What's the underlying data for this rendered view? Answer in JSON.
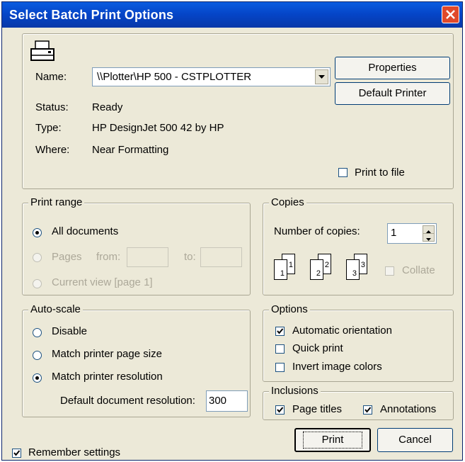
{
  "window": {
    "title": "Select Batch Print Options"
  },
  "printer": {
    "name_label": "Name:",
    "name_value": "\\\\Plotter\\HP 500 - CSTPLOTTER",
    "status_label": "Status:",
    "status_value": "Ready",
    "type_label": "Type:",
    "type_value": "HP DesignJet 500 42 by HP",
    "where_label": "Where:",
    "where_value": "Near Formatting",
    "properties_label": "Properties",
    "default_printer_label": "Default Printer",
    "print_to_file_label": "Print to file",
    "print_to_file_checked": false
  },
  "print_range": {
    "legend": "Print range",
    "all_documents_label": "All documents",
    "pages_label": "Pages",
    "from_label": "from:",
    "to_label": "to:",
    "from_value": "",
    "to_value": "",
    "current_view_label": "Current view [page 1]",
    "selected": "All documents"
  },
  "copies": {
    "legend": "Copies",
    "number_label": "Number of copies:",
    "number_value": "1",
    "collate_label": "Collate",
    "collate_checked": false,
    "page_digits": [
      "1",
      "1",
      "2",
      "2",
      "3",
      "3"
    ]
  },
  "auto_scale": {
    "legend": "Auto-scale",
    "disable_label": "Disable",
    "match_page_size_label": "Match printer page size",
    "match_resolution_label": "Match printer resolution",
    "selected": "Match printer resolution",
    "default_resolution_label": "Default document resolution:",
    "default_resolution_value": "300"
  },
  "options": {
    "legend": "Options",
    "automatic_orientation_label": "Automatic orientation",
    "automatic_orientation_checked": true,
    "quick_print_label": "Quick print",
    "quick_print_checked": false,
    "invert_colors_label": "Invert image colors",
    "invert_colors_checked": false
  },
  "inclusions": {
    "legend": "Inclusions",
    "page_titles_label": "Page titles",
    "page_titles_checked": true,
    "annotations_label": "Annotations",
    "annotations_checked": true
  },
  "footer": {
    "remember_label": "Remember settings",
    "remember_checked": true,
    "print_label": "Print",
    "cancel_label": "Cancel"
  },
  "icons": [
    "printer-icon",
    "close-icon",
    "dropdown-arrow-icon",
    "spinner-up-icon",
    "spinner-down-icon",
    "collate-pages-icon"
  ],
  "colors": {
    "titlebar": "#0544c6",
    "close": "#e0492a",
    "dialog_bg": "#ece9d8",
    "disabled_text": "#aca899"
  }
}
